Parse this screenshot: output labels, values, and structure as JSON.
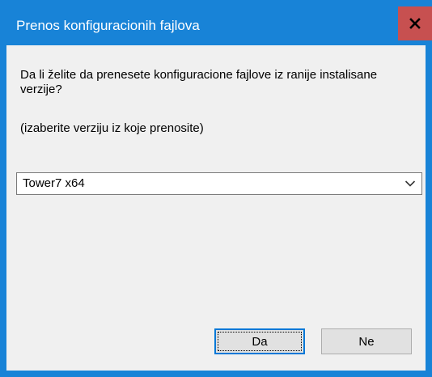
{
  "window": {
    "title": "Prenos konfiguracionih fajlova",
    "accent_color": "#1883d7",
    "close_button_color": "#c75050",
    "close_icon": "close-icon"
  },
  "dialog": {
    "question": "Da li želite da prenesete konfiguracione fajlove iz ranije instalisane verzije?",
    "hint": "(izaberite verziju iz koje prenosite)",
    "version_select": {
      "selected": "Tower7 x64",
      "arrow_icon": "chevron-down-icon"
    },
    "buttons": {
      "yes_label": "Da",
      "no_label": "Ne"
    }
  }
}
